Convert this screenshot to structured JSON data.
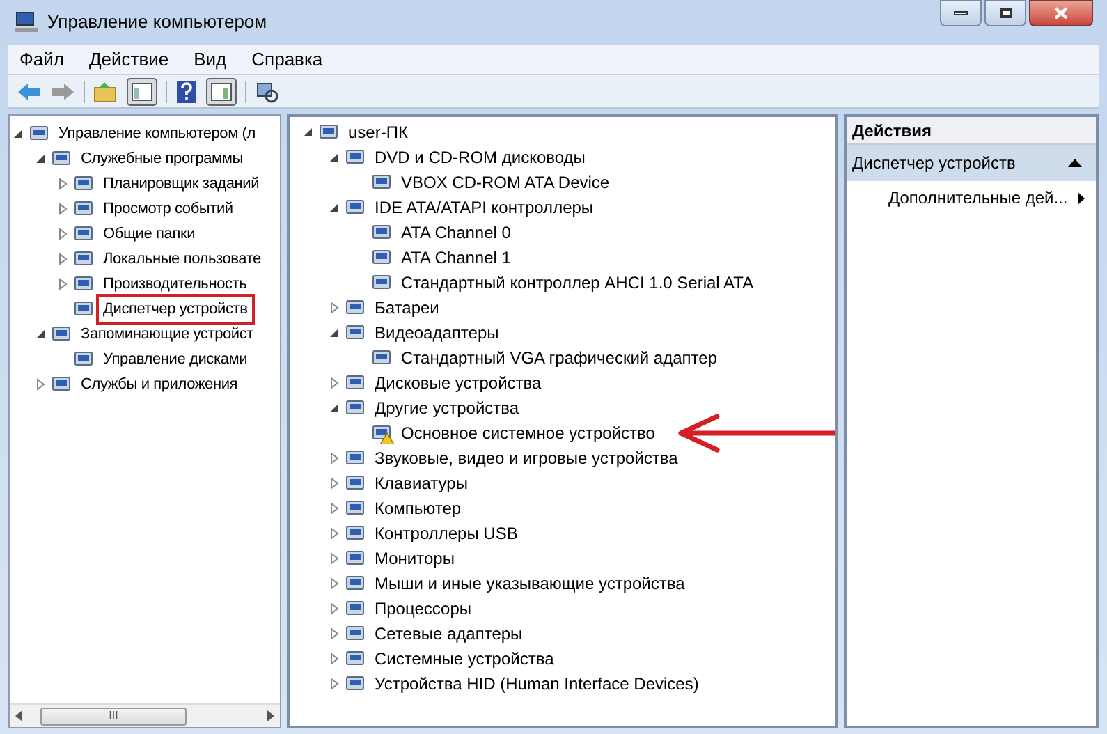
{
  "window": {
    "title": "Управление компьютером"
  },
  "menu": [
    "Файл",
    "Действие",
    "Вид",
    "Справка"
  ],
  "left_tree": [
    {
      "label": "Управление компьютером (л",
      "expanded": true,
      "children": [
        {
          "label": "Служебные программы",
          "expanded": true,
          "children": [
            {
              "label": "Планировщик заданий",
              "expanded": false
            },
            {
              "label": "Просмотр событий",
              "expanded": false
            },
            {
              "label": "Общие папки",
              "expanded": false
            },
            {
              "label": "Локальные пользовате",
              "expanded": false
            },
            {
              "label": "Производительность",
              "expanded": false
            },
            {
              "label": "Диспетчер устройств",
              "marked": true
            }
          ]
        },
        {
          "label": "Запоминающие устройст",
          "expanded": true,
          "children": [
            {
              "label": "Управление дисками"
            }
          ]
        },
        {
          "label": "Службы и приложения",
          "expanded": false
        }
      ]
    }
  ],
  "device_tree": [
    {
      "label": "user-ПК",
      "expanded": true,
      "children": [
        {
          "label": "DVD и CD-ROM дисководы",
          "expanded": true,
          "children": [
            {
              "label": "VBOX CD-ROM ATA Device"
            }
          ]
        },
        {
          "label": "IDE ATA/ATAPI контроллеры",
          "expanded": true,
          "children": [
            {
              "label": "ATA Channel 0"
            },
            {
              "label": "ATA Channel 1"
            },
            {
              "label": "Стандартный контроллер AHCI 1.0 Serial ATA"
            }
          ]
        },
        {
          "label": "Батареи",
          "expanded": false
        },
        {
          "label": "Видеоадаптеры",
          "expanded": true,
          "children": [
            {
              "label": "Стандартный VGA графический адаптер"
            }
          ]
        },
        {
          "label": "Дисковые устройства",
          "expanded": false
        },
        {
          "label": "Другие устройства",
          "expanded": true,
          "children": [
            {
              "label": "Основное системное устройство",
              "warning": true,
              "pointed": true
            }
          ]
        },
        {
          "label": "Звуковые, видео и игровые устройства",
          "expanded": false
        },
        {
          "label": "Клавиатуры",
          "expanded": false
        },
        {
          "label": "Компьютер",
          "expanded": false
        },
        {
          "label": "Контроллеры USB",
          "expanded": false
        },
        {
          "label": "Мониторы",
          "expanded": false
        },
        {
          "label": "Мыши и иные указывающие устройства",
          "expanded": false
        },
        {
          "label": "Процессоры",
          "expanded": false
        },
        {
          "label": "Сетевые адаптеры",
          "expanded": false
        },
        {
          "label": "Системные устройства",
          "expanded": false
        },
        {
          "label": "Устройства HID (Human Interface Devices)",
          "expanded": false
        }
      ]
    }
  ],
  "actions": {
    "title": "Действия",
    "section": {
      "label": "Диспетчер устройств",
      "expanded": true
    },
    "items": [
      "Дополнительные дей..."
    ]
  },
  "left_scrollbar": {
    "thumb_label": "III"
  }
}
